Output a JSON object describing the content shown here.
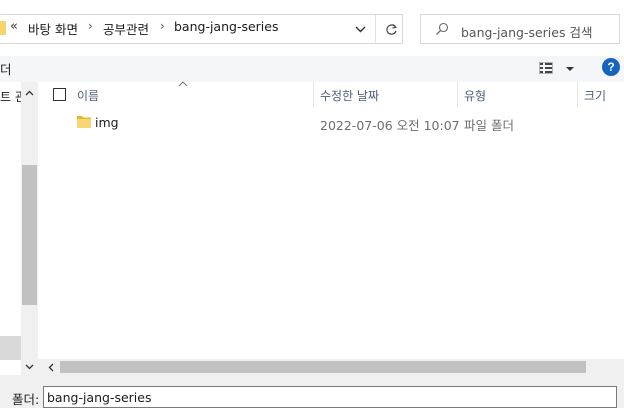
{
  "address_bar": {
    "overflow": "«",
    "breadcrumbs": [
      "바탕 화면",
      "공부관련",
      "bang-jang-series"
    ],
    "separator": "›",
    "dropdown_icon": "chevron-down-icon",
    "refresh_icon": "refresh-icon"
  },
  "search": {
    "placeholder": "bang-jang-series 검색",
    "icon": "search-icon"
  },
  "toolbar": {
    "left_label": "더",
    "view_icon": "view-options-icon",
    "help_label": "?"
  },
  "nav_pane": {
    "partial_label": "트 관"
  },
  "file_list": {
    "columns": [
      "이름",
      "수정한 날짜",
      "유형",
      "크기"
    ],
    "rows": [
      {
        "name": "img",
        "modified": "2022-07-06 오전 10:07",
        "type": "파일 폴더",
        "size": ""
      }
    ]
  },
  "bottom_bar": {
    "folder_label": "폴더:",
    "folder_value": "bang-jang-series"
  },
  "colors": {
    "folder_yellow": "#f6d36b",
    "help_blue": "#1565c0",
    "header_text": "#4c607a"
  }
}
